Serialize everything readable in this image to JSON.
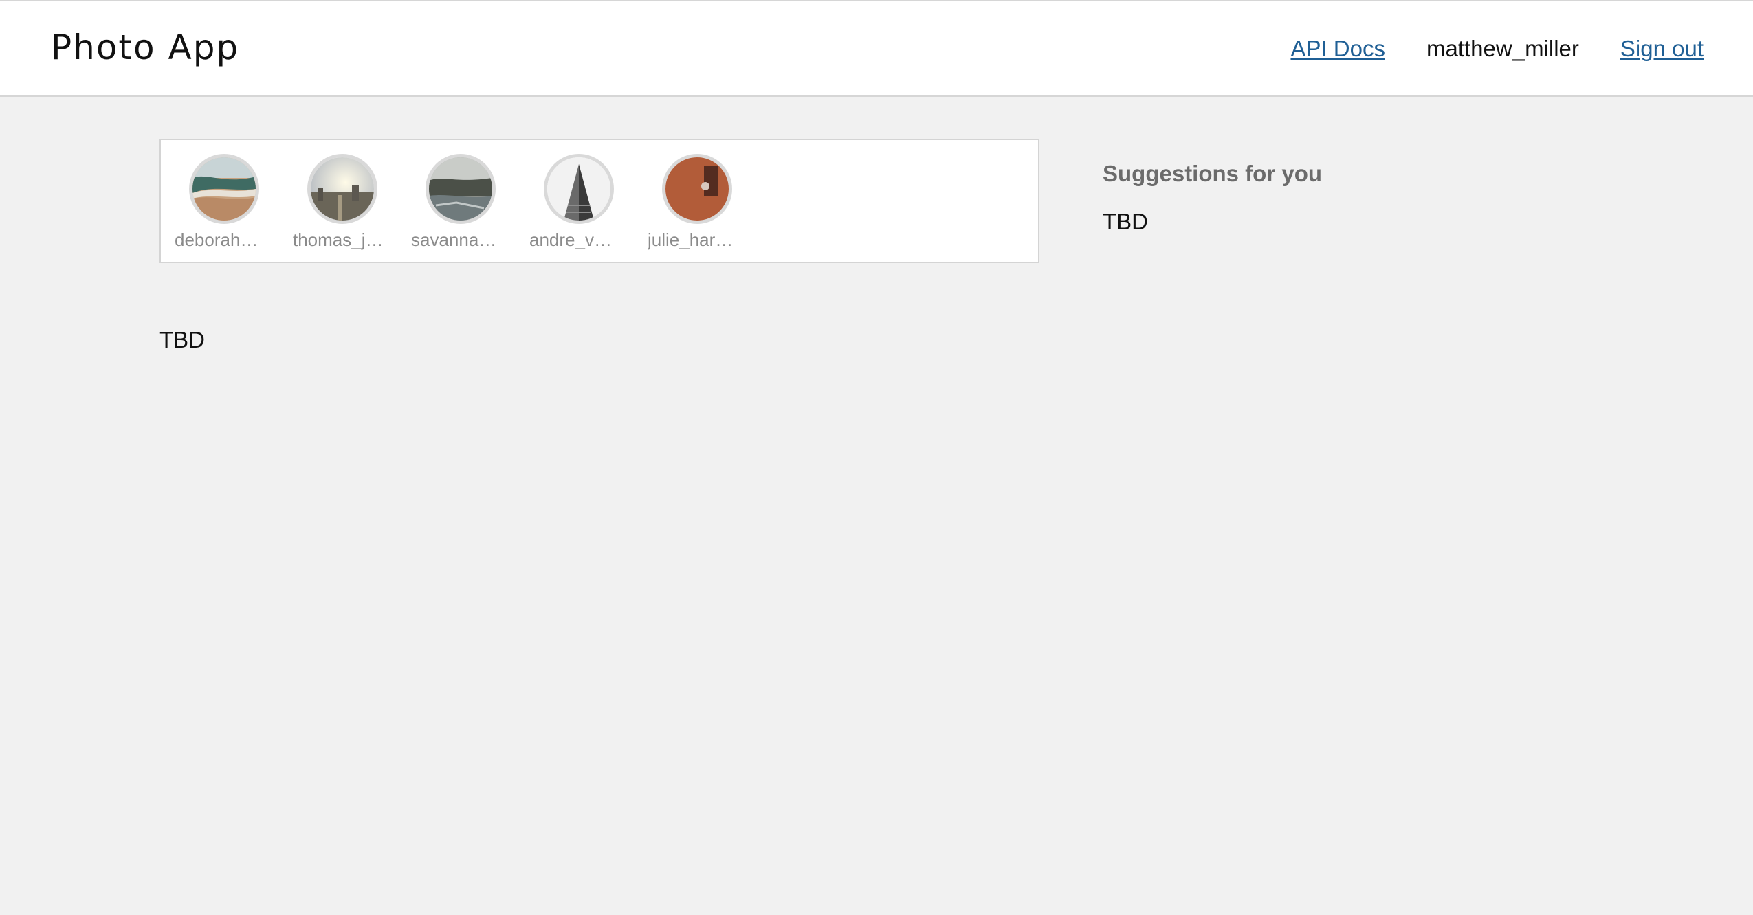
{
  "header": {
    "app_title": "Photo App",
    "nav": {
      "api_docs_label": "API Docs",
      "username": "matthew_miller",
      "sign_out_label": "Sign out"
    },
    "link_color": "#1f5f95"
  },
  "stories": [
    {
      "username": "deborah…",
      "avatar": "beach-photo"
    },
    {
      "username": "thomas_j…",
      "avatar": "city-skyline-photo"
    },
    {
      "username": "savanna…",
      "avatar": "misty-river-photo"
    },
    {
      "username": "andre_v…",
      "avatar": "flatiron-building-photo"
    },
    {
      "username": "julie_har…",
      "avatar": "brick-wall-photo"
    }
  ],
  "feed": {
    "placeholder": "TBD"
  },
  "suggestions": {
    "title": "Suggestions for you",
    "body": "TBD"
  }
}
